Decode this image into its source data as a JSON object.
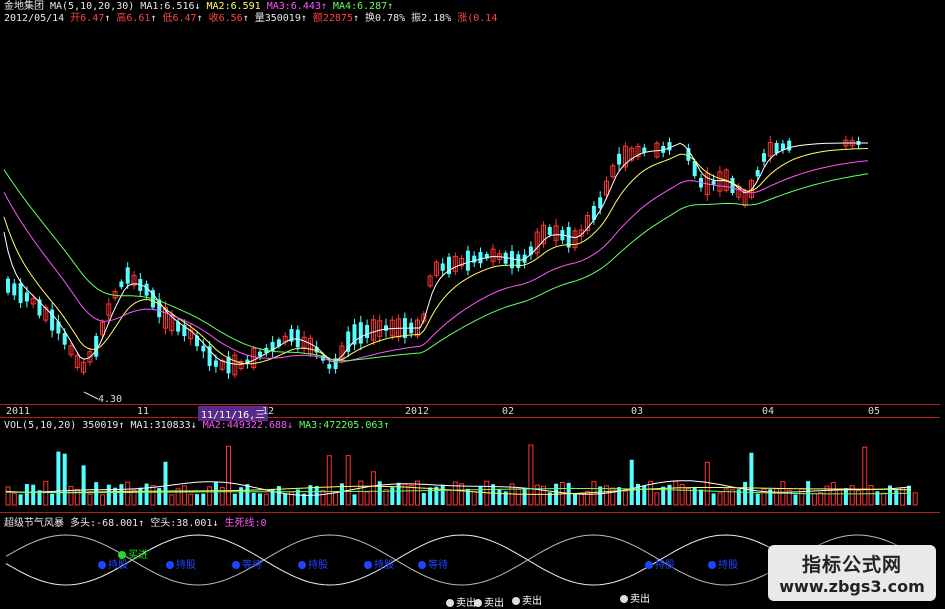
{
  "header": {
    "stock_name": "金地集团",
    "ma_label": "MA(5,10,20,30)",
    "ma1": "MA1:6.516",
    "ma1_arrow": "↓",
    "ma2": "MA2:6.591",
    "ma3": "MA3:6.443",
    "ma3_arrow": "↑",
    "ma4": "MA4:6.287",
    "ma4_arrow": "↑",
    "date": "2012/05/14",
    "open": "开6.47",
    "open_arrow": "↑",
    "high": "高6.61",
    "high_arrow": "↑",
    "low": "低6.47",
    "low_arrow": "↑",
    "close": "收6.56",
    "close_arrow": "↑",
    "volume": "量350019",
    "volume_arrow": "↑",
    "amount": "额22875",
    "amount_arrow": "↑",
    "turnover": "换0.78%",
    "amplitude": "振2.18%",
    "change": "涨(0.14"
  },
  "price_panel": {
    "low_marker": "4.30",
    "x_labels": [
      "2011",
      "11",
      "11/11/16,三",
      "12",
      "2012",
      "02",
      "03",
      "04",
      "05"
    ]
  },
  "volume_panel": {
    "label": "VOL(5,10,20)",
    "vol": "350019",
    "vol_arrow": "↑",
    "ma1": "MA1:310833",
    "ma1_arrow": "↓",
    "ma2": "MA2:449322.688",
    "ma2_arrow": "↓",
    "ma3": "MA3:472205.063",
    "ma3_arrow": "↑"
  },
  "indicator_panel": {
    "name": "超级节气风暴",
    "long": "多头:-68.001",
    "long_arrow": "↑",
    "short": "空头:38.001",
    "short_arrow": "↓",
    "line": "生死线:0",
    "signals": {
      "buy": "买进",
      "sell": "卖出",
      "hold_watch": "持股",
      "wait": "等待"
    }
  },
  "watermark": {
    "title": "指标公式网",
    "url": "www.zbgs3.com"
  },
  "colors": {
    "up": "#ff3333",
    "down": "#55ffff",
    "ma5": "#ffffff",
    "ma10": "#ffff66",
    "ma20": "#ff55ff",
    "ma30": "#66ff66",
    "grid": "#b02020",
    "signal_blue": "#2244ff",
    "signal_green": "#22dd22"
  }
}
